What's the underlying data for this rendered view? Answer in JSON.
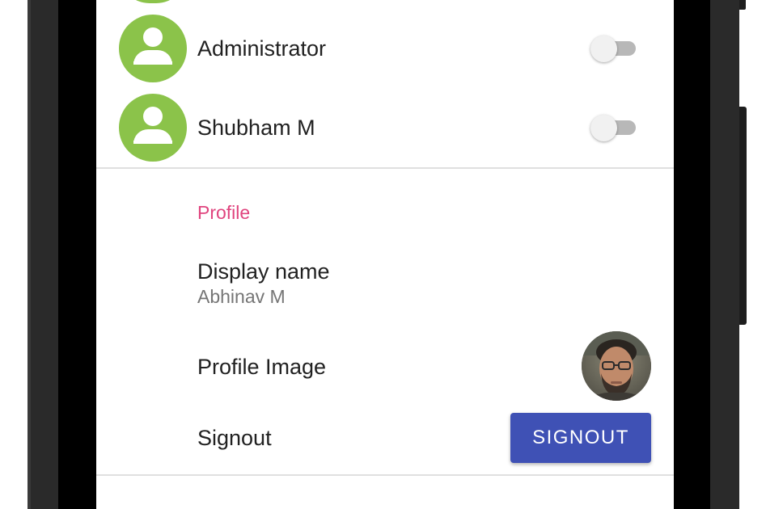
{
  "users": [
    {
      "name": "Administrator",
      "enabled": false,
      "avatar_icon": "user-avatar-icon"
    },
    {
      "name": "Shubham M",
      "enabled": false,
      "avatar_icon": "user-avatar-icon"
    }
  ],
  "profile": {
    "section_title": "Profile",
    "display_name": {
      "title": "Display name",
      "value": "Abhinav M"
    },
    "profile_image": {
      "title": "Profile Image"
    },
    "signout": {
      "title": "Signout",
      "button_label": "SIGNOUT"
    }
  },
  "colors": {
    "avatar_bg": "#8bc34a",
    "accent": "#e0447e",
    "primary_button": "#3f51b5",
    "switch_track_off": "#b8b8b8",
    "switch_thumb_off": "#f1f1f1"
  }
}
